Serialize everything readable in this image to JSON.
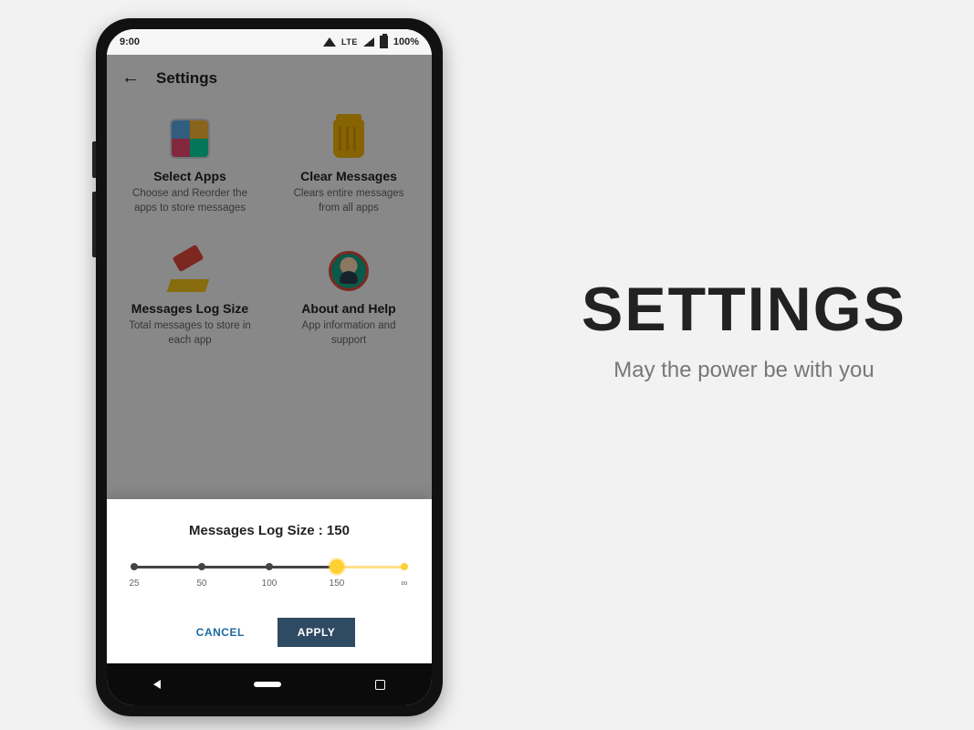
{
  "promo": {
    "title": "SETTINGS",
    "subtitle": "May the power be with you"
  },
  "status": {
    "time": "9:00",
    "lte": "LTE",
    "battery": "100%"
  },
  "topbar": {
    "title": "Settings"
  },
  "cards": {
    "select_apps": {
      "title": "Select Apps",
      "desc": "Choose and Reorder the apps to store messages"
    },
    "clear_messages": {
      "title": "Clear Messages",
      "desc": "Clears entire messages from all apps"
    },
    "log_size": {
      "title": "Messages Log Size",
      "desc": "Total messages to store in each app"
    },
    "about": {
      "title": "About and Help",
      "desc": "App information and support"
    }
  },
  "dialog": {
    "title_prefix": "Messages Log Size  : ",
    "value": "150",
    "ticks": [
      "25",
      "50",
      "100",
      "150",
      "∞"
    ],
    "selected_index": 3,
    "cancel": "CANCEL",
    "apply": "APPLY"
  }
}
